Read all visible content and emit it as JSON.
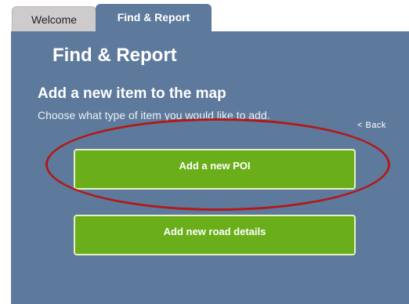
{
  "tabs": {
    "welcome_label": "Welcome",
    "find_report_label": "Find & Report"
  },
  "panel": {
    "page_title": "Find & Report",
    "section_heading": "Add a new item to the map",
    "instruction": "Choose what type of item you would like to add.",
    "back_label": "< Back"
  },
  "actions": {
    "add_poi_label": "Add a new POI",
    "add_road_label": "Add new road details"
  },
  "colors": {
    "panel_background": "#5d7a9c",
    "button_green": "#6aaf1a",
    "annotation_red": "#b01a1a",
    "inactive_tab": "#cdcbcb"
  }
}
